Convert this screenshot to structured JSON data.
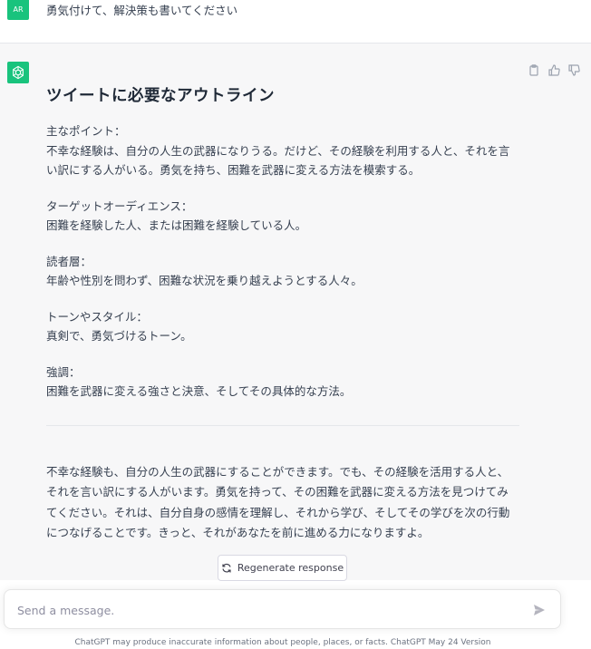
{
  "user_message": {
    "avatar_initials": "AR",
    "text": "勇気付けて、解決策も書いてください"
  },
  "assistant_message": {
    "heading": "ツイートに必要なアウトライン",
    "sections": [
      {
        "label": "主なポイント：",
        "body": "不幸な経験は、自分の人生の武器になりうる。だけど、その経験を利用する人と、それを言い訳にする人がいる。勇気を持ち、困難を武器に変える方法を模索する。"
      },
      {
        "label": "ターゲットオーディエンス：",
        "body": "困難を経験した人、または困難を経験している人。"
      },
      {
        "label": "読者層：",
        "body": "年齢や性別を問わず、困難な状況を乗り越えようとする人々。"
      },
      {
        "label": "トーンやスタイル：",
        "body": "真剣で、勇気づけるトーン。"
      },
      {
        "label": "強調：",
        "body": "困難を武器に変える強さと決意、そしてその具体的な方法。"
      }
    ],
    "closing": "不幸な経験も、自分の人生の武器にすることができます。でも、その経験を活用する人と、それを言い訳にする人がいます。勇気を持って、その困難を武器に変える方法を見つけてみてください。それは、自分自身の感情を理解し、それから学び、そしてその学びを次の行動につなげることです。きっと、それがあなたを前に進める力になりますよ。"
  },
  "regenerate_label": "Regenerate response",
  "composer": {
    "placeholder": "Send a message."
  },
  "footer": "ChatGPT may produce inaccurate information about people, places, or facts. ChatGPT May 24 Version",
  "icons": {
    "copy": "clipboard-icon",
    "like": "thumbs-up-icon",
    "dislike": "thumbs-down-icon",
    "regenerate": "refresh-icon",
    "send": "send-icon",
    "assistant": "openai-logo-icon"
  },
  "colors": {
    "accent": "#19c37d",
    "assistant_bg": "#f7f7f8"
  }
}
